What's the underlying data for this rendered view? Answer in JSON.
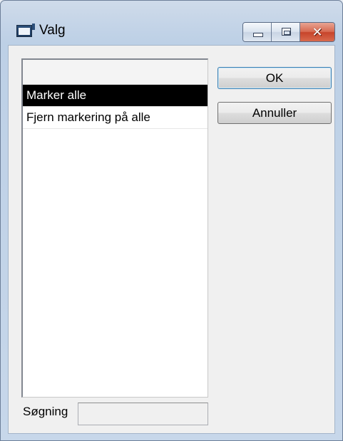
{
  "window": {
    "title": "Valg",
    "icons": {
      "app": "window-app-icon",
      "minimize": "minimize-icon",
      "maximize": "maximize-icon",
      "close": "close-icon"
    },
    "close_glyph": "✕",
    "colors": {
      "selection_background": "#000000",
      "selection_text": "#ffffff",
      "close_button": "#c7442b"
    }
  },
  "list": {
    "items": [
      {
        "label": "Marker alle",
        "selected": true
      },
      {
        "label": "Fjern markering på alle",
        "selected": false
      }
    ]
  },
  "buttons": {
    "ok_label": "OK",
    "cancel_label": "Annuller"
  },
  "search": {
    "label": "Søgning",
    "value": ""
  }
}
